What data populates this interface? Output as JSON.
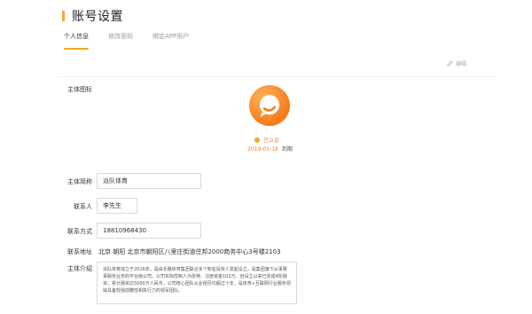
{
  "header": {
    "title": "账号设置"
  },
  "tabs": [
    {
      "label": "个人信息",
      "active": true
    },
    {
      "label": "修改密码",
      "active": false
    },
    {
      "label": "绑定APP用户",
      "active": false
    }
  ],
  "toolbar": {
    "edit_label": "编辑"
  },
  "form": {
    "avatar_label": "主体图标",
    "certification": {
      "status": "已认证",
      "expire_date": "2019-01-18",
      "expire_suffix": "到期"
    },
    "name_label": "主体简称",
    "name_value": "派队体育",
    "contact_label": "联系人",
    "contact_value": "李先生",
    "phone_label": "联系方式",
    "phone_value": "18810968430",
    "address_label": "联系地址",
    "address_value": "北京 朝阳 北京市朝阳区八里庄街道住邦2000商务中心3号楼2103",
    "intro_label": "主体介绍",
    "intro_value": "派队体育成立于2016年，是由长路体育集团联合多个知名投资人发起设立，是集团旗下从事赛事服务业务的平台级公司，公司实际控制人为张特，注册资金102万。自设立以来已完成4轮融资，累计融资达5000万人民币，公司核心团队从业经历均超过十年，是体育+互联网行业服务领域具备较强前瞻性和执行力的领军团队。"
  },
  "colors": {
    "accent": "#f5a623",
    "brand_orange": "#f57c1a",
    "border": "#d9d9d9"
  }
}
